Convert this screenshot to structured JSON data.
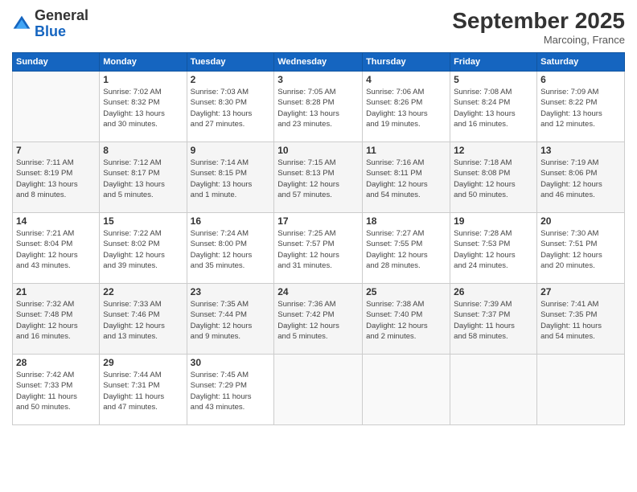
{
  "logo": {
    "general": "General",
    "blue": "Blue"
  },
  "header": {
    "month": "September 2025",
    "location": "Marcoing, France"
  },
  "weekdays": [
    "Sunday",
    "Monday",
    "Tuesday",
    "Wednesday",
    "Thursday",
    "Friday",
    "Saturday"
  ],
  "weeks": [
    [
      {
        "day": "",
        "info": ""
      },
      {
        "day": "1",
        "info": "Sunrise: 7:02 AM\nSunset: 8:32 PM\nDaylight: 13 hours\nand 30 minutes."
      },
      {
        "day": "2",
        "info": "Sunrise: 7:03 AM\nSunset: 8:30 PM\nDaylight: 13 hours\nand 27 minutes."
      },
      {
        "day": "3",
        "info": "Sunrise: 7:05 AM\nSunset: 8:28 PM\nDaylight: 13 hours\nand 23 minutes."
      },
      {
        "day": "4",
        "info": "Sunrise: 7:06 AM\nSunset: 8:26 PM\nDaylight: 13 hours\nand 19 minutes."
      },
      {
        "day": "5",
        "info": "Sunrise: 7:08 AM\nSunset: 8:24 PM\nDaylight: 13 hours\nand 16 minutes."
      },
      {
        "day": "6",
        "info": "Sunrise: 7:09 AM\nSunset: 8:22 PM\nDaylight: 13 hours\nand 12 minutes."
      }
    ],
    [
      {
        "day": "7",
        "info": "Sunrise: 7:11 AM\nSunset: 8:19 PM\nDaylight: 13 hours\nand 8 minutes."
      },
      {
        "day": "8",
        "info": "Sunrise: 7:12 AM\nSunset: 8:17 PM\nDaylight: 13 hours\nand 5 minutes."
      },
      {
        "day": "9",
        "info": "Sunrise: 7:14 AM\nSunset: 8:15 PM\nDaylight: 13 hours\nand 1 minute."
      },
      {
        "day": "10",
        "info": "Sunrise: 7:15 AM\nSunset: 8:13 PM\nDaylight: 12 hours\nand 57 minutes."
      },
      {
        "day": "11",
        "info": "Sunrise: 7:16 AM\nSunset: 8:11 PM\nDaylight: 12 hours\nand 54 minutes."
      },
      {
        "day": "12",
        "info": "Sunrise: 7:18 AM\nSunset: 8:08 PM\nDaylight: 12 hours\nand 50 minutes."
      },
      {
        "day": "13",
        "info": "Sunrise: 7:19 AM\nSunset: 8:06 PM\nDaylight: 12 hours\nand 46 minutes."
      }
    ],
    [
      {
        "day": "14",
        "info": "Sunrise: 7:21 AM\nSunset: 8:04 PM\nDaylight: 12 hours\nand 43 minutes."
      },
      {
        "day": "15",
        "info": "Sunrise: 7:22 AM\nSunset: 8:02 PM\nDaylight: 12 hours\nand 39 minutes."
      },
      {
        "day": "16",
        "info": "Sunrise: 7:24 AM\nSunset: 8:00 PM\nDaylight: 12 hours\nand 35 minutes."
      },
      {
        "day": "17",
        "info": "Sunrise: 7:25 AM\nSunset: 7:57 PM\nDaylight: 12 hours\nand 31 minutes."
      },
      {
        "day": "18",
        "info": "Sunrise: 7:27 AM\nSunset: 7:55 PM\nDaylight: 12 hours\nand 28 minutes."
      },
      {
        "day": "19",
        "info": "Sunrise: 7:28 AM\nSunset: 7:53 PM\nDaylight: 12 hours\nand 24 minutes."
      },
      {
        "day": "20",
        "info": "Sunrise: 7:30 AM\nSunset: 7:51 PM\nDaylight: 12 hours\nand 20 minutes."
      }
    ],
    [
      {
        "day": "21",
        "info": "Sunrise: 7:32 AM\nSunset: 7:48 PM\nDaylight: 12 hours\nand 16 minutes."
      },
      {
        "day": "22",
        "info": "Sunrise: 7:33 AM\nSunset: 7:46 PM\nDaylight: 12 hours\nand 13 minutes."
      },
      {
        "day": "23",
        "info": "Sunrise: 7:35 AM\nSunset: 7:44 PM\nDaylight: 12 hours\nand 9 minutes."
      },
      {
        "day": "24",
        "info": "Sunrise: 7:36 AM\nSunset: 7:42 PM\nDaylight: 12 hours\nand 5 minutes."
      },
      {
        "day": "25",
        "info": "Sunrise: 7:38 AM\nSunset: 7:40 PM\nDaylight: 12 hours\nand 2 minutes."
      },
      {
        "day": "26",
        "info": "Sunrise: 7:39 AM\nSunset: 7:37 PM\nDaylight: 11 hours\nand 58 minutes."
      },
      {
        "day": "27",
        "info": "Sunrise: 7:41 AM\nSunset: 7:35 PM\nDaylight: 11 hours\nand 54 minutes."
      }
    ],
    [
      {
        "day": "28",
        "info": "Sunrise: 7:42 AM\nSunset: 7:33 PM\nDaylight: 11 hours\nand 50 minutes."
      },
      {
        "day": "29",
        "info": "Sunrise: 7:44 AM\nSunset: 7:31 PM\nDaylight: 11 hours\nand 47 minutes."
      },
      {
        "day": "30",
        "info": "Sunrise: 7:45 AM\nSunset: 7:29 PM\nDaylight: 11 hours\nand 43 minutes."
      },
      {
        "day": "",
        "info": ""
      },
      {
        "day": "",
        "info": ""
      },
      {
        "day": "",
        "info": ""
      },
      {
        "day": "",
        "info": ""
      }
    ]
  ]
}
